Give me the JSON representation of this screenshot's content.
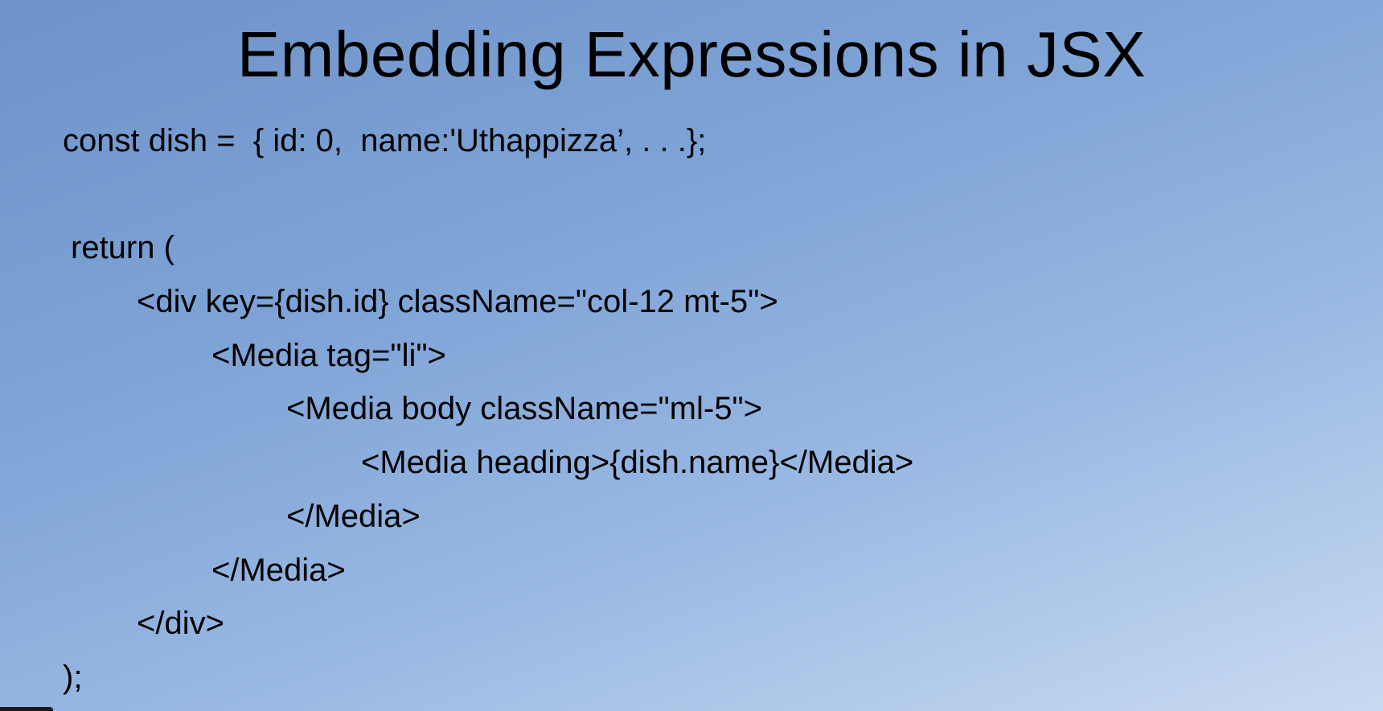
{
  "slide": {
    "title": "Embedding Expressions in JSX",
    "code_lines": [
      "const dish =  { id: 0,  name:'Uthappizza’, . . .};",
      "return (",
      "<div key={dish.id} className=\"col-12 mt-5\">",
      "<Media tag=\"li\">",
      "<Media body className=\"ml-5\">",
      "<Media heading>{dish.name}</Media>",
      "</Media>",
      "</Media>",
      "</div>",
      ");"
    ]
  },
  "colors": {
    "background_start": "#6f93c9",
    "background_end": "#c9daf1",
    "text": "#000000"
  }
}
